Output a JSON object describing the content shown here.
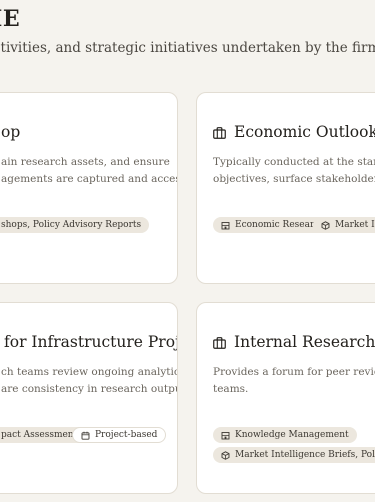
{
  "header": {
    "title": "ME",
    "subtitle": "ctivities, and strategic initiatives undertaken by the firm."
  },
  "cards": [
    {
      "title": "op",
      "desc_line1": "ain research assets, and ensure",
      "desc_line2": "agements are captured and accessible.",
      "tags": [
        "shops, Policy Advisory Reports"
      ]
    },
    {
      "title": "Economic Outlook Repo",
      "desc_line1": "Typically conducted at the start of a c",
      "desc_line2": "objectives, surface stakeholder expecta",
      "tags": [
        "Economic Research",
        "Market Intel"
      ]
    },
    {
      "title": "for Infrastructure Project",
      "desc_line1": "ch teams review ongoing analytical",
      "desc_line2": "are consistency in research outputs.",
      "tags": [
        "pact Assessments",
        "Project-based"
      ]
    },
    {
      "title": "Internal Research Revie",
      "desc_line1": "Provides a forum for peer review and k",
      "desc_line2": "teams.",
      "tags": [
        "Knowledge Management",
        "Market Intelligence Briefs, Policy Adviso"
      ]
    }
  ],
  "icons": {
    "title": "briefcase-icon",
    "tag_research": "building-icon",
    "tag_market": "cube-icon",
    "tag_calendar": "calendar-icon"
  },
  "colors": {
    "background": "#f5f3ee",
    "card": "#ffffff",
    "tag_fill": "#ece7de",
    "text_primary": "#23201c",
    "text_muted": "#6b665e"
  }
}
